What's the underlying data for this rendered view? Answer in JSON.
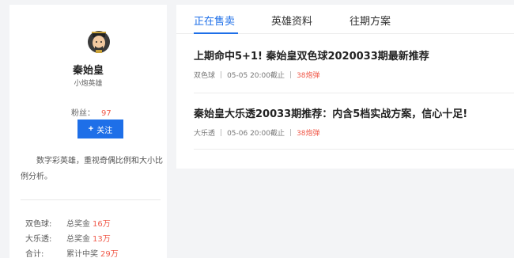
{
  "profile": {
    "avatar_icon": "emperor-avatar",
    "name": "秦始皇",
    "title": "小炮英雄",
    "fans_label": "粉丝：",
    "fans_count": "97",
    "follow_label": "关注",
    "bio": "数字彩英雄，重视奇偶比例和大小比例分析。"
  },
  "stats": [
    {
      "key": "双色球:",
      "label": "总奖金",
      "value": "16万"
    },
    {
      "key": "大乐透:",
      "label": "总奖金",
      "value": "13万"
    },
    {
      "key": "合计:",
      "label": "累计中奖",
      "value": "29万"
    }
  ],
  "tabs": [
    {
      "label": "正在售卖",
      "active": true
    },
    {
      "label": "英雄资料",
      "active": false
    },
    {
      "label": "往期方案",
      "active": false
    }
  ],
  "articles": [
    {
      "title": "上期命中5+1! 秦始皇双色球2020033期最新推荐",
      "lottery": "双色球",
      "deadline": "05-05 20:00截止",
      "price": "38炮弹"
    },
    {
      "title": "秦始皇大乐透20033期推荐：内含5档实战方案，信心十足!",
      "lottery": "大乐透",
      "deadline": "05-06 20:00截止",
      "price": "38炮弹"
    }
  ],
  "colors": {
    "accent": "#1e6fe8",
    "highlight": "#f05a4a"
  }
}
